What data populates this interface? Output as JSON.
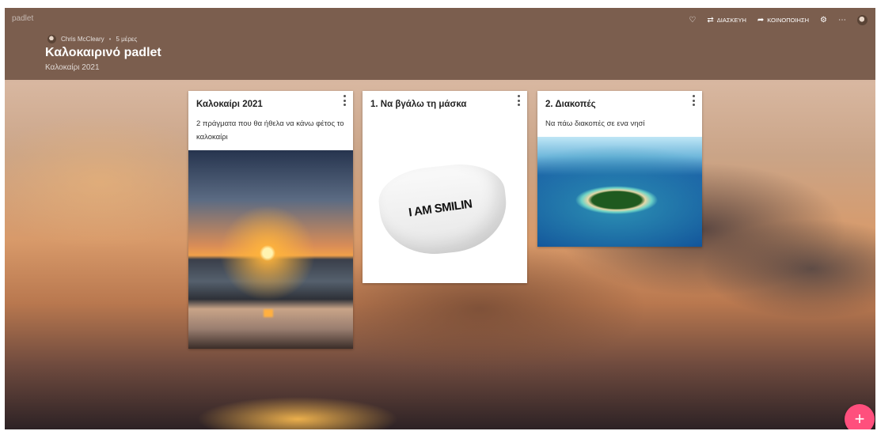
{
  "app": {
    "logo": "padlet"
  },
  "header": {
    "author": "Chris McCleary",
    "separator": "•",
    "time": "5 μέρες",
    "title": "Καλοκαιρινό padlet",
    "subtitle": "Καλοκαίρι 2021",
    "color": "#7b5e4e"
  },
  "actions": {
    "like_icon": "heart-icon",
    "remake_label": "ΔΙΑΣΚΕΥΗ",
    "share_label": "ΚΟΙΝΟΠΟΙΗΣΗ",
    "settings_icon": "gear-icon",
    "more_icon": "more-icon"
  },
  "cards": [
    {
      "title": "Καλοκαίρι 2021",
      "description": "2 πράγματα που θα ήθελα να κάνω φέτος το καλοκαίρι",
      "image": "sunset-beach-image"
    },
    {
      "title": "1. Να βγάλω τη μάσκα",
      "description": "",
      "image": "face-mask-image",
      "image_text": "I AM SMILIN"
    },
    {
      "title": "2. Διακοπές",
      "description": "Να πάω διακοπές σε ενα νησί",
      "image": "island-image"
    }
  ],
  "fab": {
    "label": "+",
    "color": "#ff4f7d"
  }
}
